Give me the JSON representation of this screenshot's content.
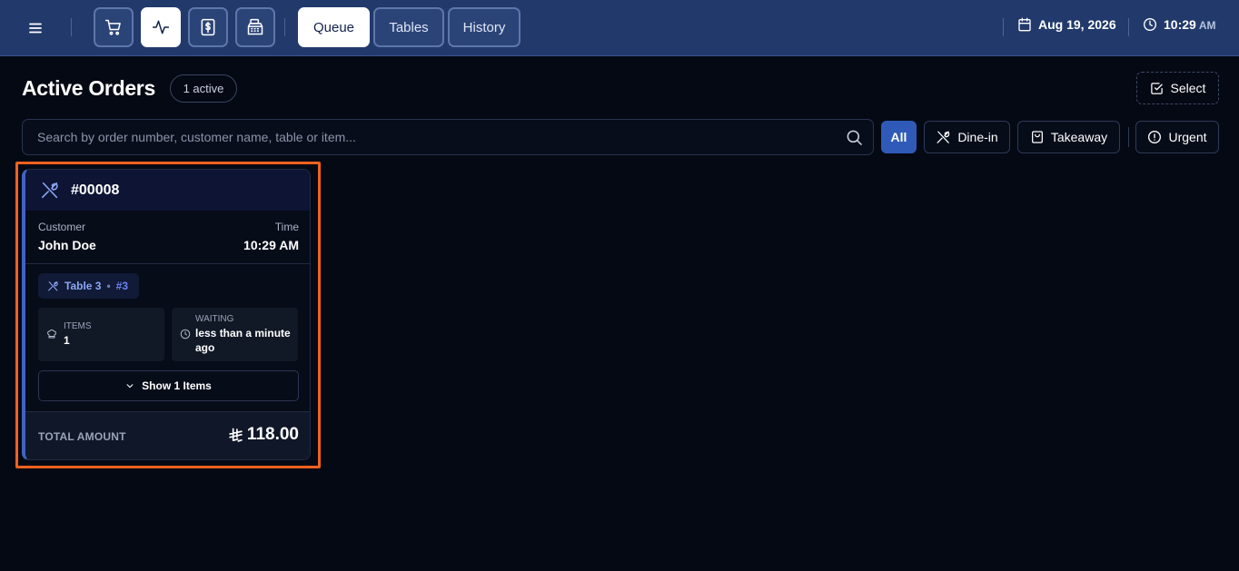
{
  "header": {
    "nav_icons": [
      {
        "icon": "cart-icon"
      },
      {
        "icon": "activity-icon",
        "active": true
      },
      {
        "icon": "dollar-icon"
      },
      {
        "icon": "cash-register-icon"
      }
    ],
    "tabs": [
      {
        "label": "Queue",
        "active": true
      },
      {
        "label": "Tables",
        "active": false
      },
      {
        "label": "History",
        "active": false
      }
    ],
    "date": "Aug 19, 2026",
    "time": "10:29",
    "ampm": "AM"
  },
  "main": {
    "title": "Active Orders",
    "active_count": "1 active",
    "select_label": "Select",
    "search": {
      "placeholder": "Search by order number, customer name, table or item...",
      "value": ""
    },
    "filters": [
      {
        "label": "All",
        "active": true
      },
      {
        "label": "Dine-in",
        "icon": "utensils-icon"
      },
      {
        "label": "Takeaway",
        "icon": "shopping-bag-icon"
      },
      {
        "label": "Urgent",
        "icon": "alert-circle-icon"
      }
    ]
  },
  "order": {
    "number": "#00008",
    "customer_label": "Customer",
    "customer": "John Doe",
    "time_label": "Time",
    "time": "10:29 AM",
    "table": "Table 3",
    "table_dot": "•",
    "table_no": "#3",
    "items_label": "ITEMS",
    "items": "1",
    "waiting_label": "WAITING",
    "waiting": "less than a minute ago",
    "show_items": "Show 1 Items",
    "total_label": "TOTAL AMOUNT",
    "total": "118.00"
  },
  "colors": {
    "header_bg": "#223a6b",
    "page_bg": "#050914",
    "accent": "#2f5ab8",
    "card_stripe": "#3f63c5",
    "highlight": "#f0611f"
  }
}
